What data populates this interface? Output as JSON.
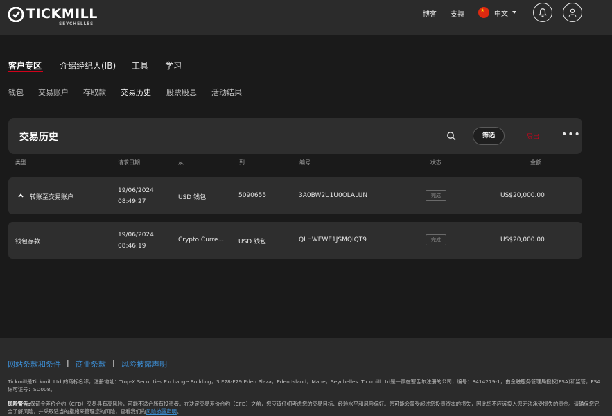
{
  "header": {
    "logo_text": "TICKMILL",
    "logo_sub": "SEYCHELLES",
    "nav": [
      "博客",
      "支持"
    ],
    "language": "中文"
  },
  "main_nav": {
    "items": [
      "客户专区",
      "介绍经纪人(IB)",
      "工具",
      "学习"
    ],
    "active": "客户专区"
  },
  "sub_nav": {
    "items": [
      "钱包",
      "交易账户",
      "存取款",
      "交易历史",
      "股票股息",
      "活动结果"
    ],
    "active": "交易历史"
  },
  "card": {
    "title": "交易历史",
    "filter_label": "筛选",
    "export_label": "导出",
    "more_label": "•••"
  },
  "table": {
    "columns": [
      "类型",
      "请求日期",
      "从",
      "到",
      "编号",
      "状态",
      "金额"
    ],
    "rows": [
      {
        "type": "转账至交易账户",
        "date": "19/06/2024",
        "time": "08:49:27",
        "from": "USD 钱包",
        "to": "5090655",
        "id": "3A0BW2U1U0OLALUN",
        "status": "完成",
        "amount": "US$20,000.00",
        "expanded": true
      },
      {
        "type": "钱包存款",
        "date": "19/06/2024",
        "time": "08:46:19",
        "from": "Crypto Curre...",
        "to": "USD 钱包",
        "id": "QLHWEWE1JSMQIQT9",
        "status": "完成",
        "amount": "US$20,000.00",
        "expanded": false
      }
    ]
  },
  "footer": {
    "links": [
      "网站条款和条件",
      "商业条款",
      "风险披露声明"
    ],
    "separator": "|",
    "company_text": "Tickmill是Tickmill Ltd.的商标名称，注册地址：Trop-X Securities Exchange Building，3 F28-F29 Eden Plaza，Eden Island，Mahe，Seychelles. Tickmill Ltd是一家在塞舌尔注册的公司，编号：8414279-1，由金融服务管理局授权(FSA)和监管，FSA许可证号：SD008。",
    "risk_label": "风险警告:",
    "risk_text": "保证金差价合约（CFD）交易具有高风险，可能不适合所有投资者。在决定交易差价合约（CFD）之前，您应该仔细考虑您的交易目标、经验水平和风险偏好。您可能会蒙受超过您投资资本的损失，因此您不应该投入您无法承受损失的资金。请确保您完全了解风险，并采取适当的措施来管理您的风险，查看我们的",
    "risk_link": "风险披露声明",
    "risk_end": "。"
  },
  "colors": {
    "accent": "#d0021b",
    "link": "#3d8fd6",
    "background": "#1a1a1a",
    "card": "#2e2e2e"
  }
}
